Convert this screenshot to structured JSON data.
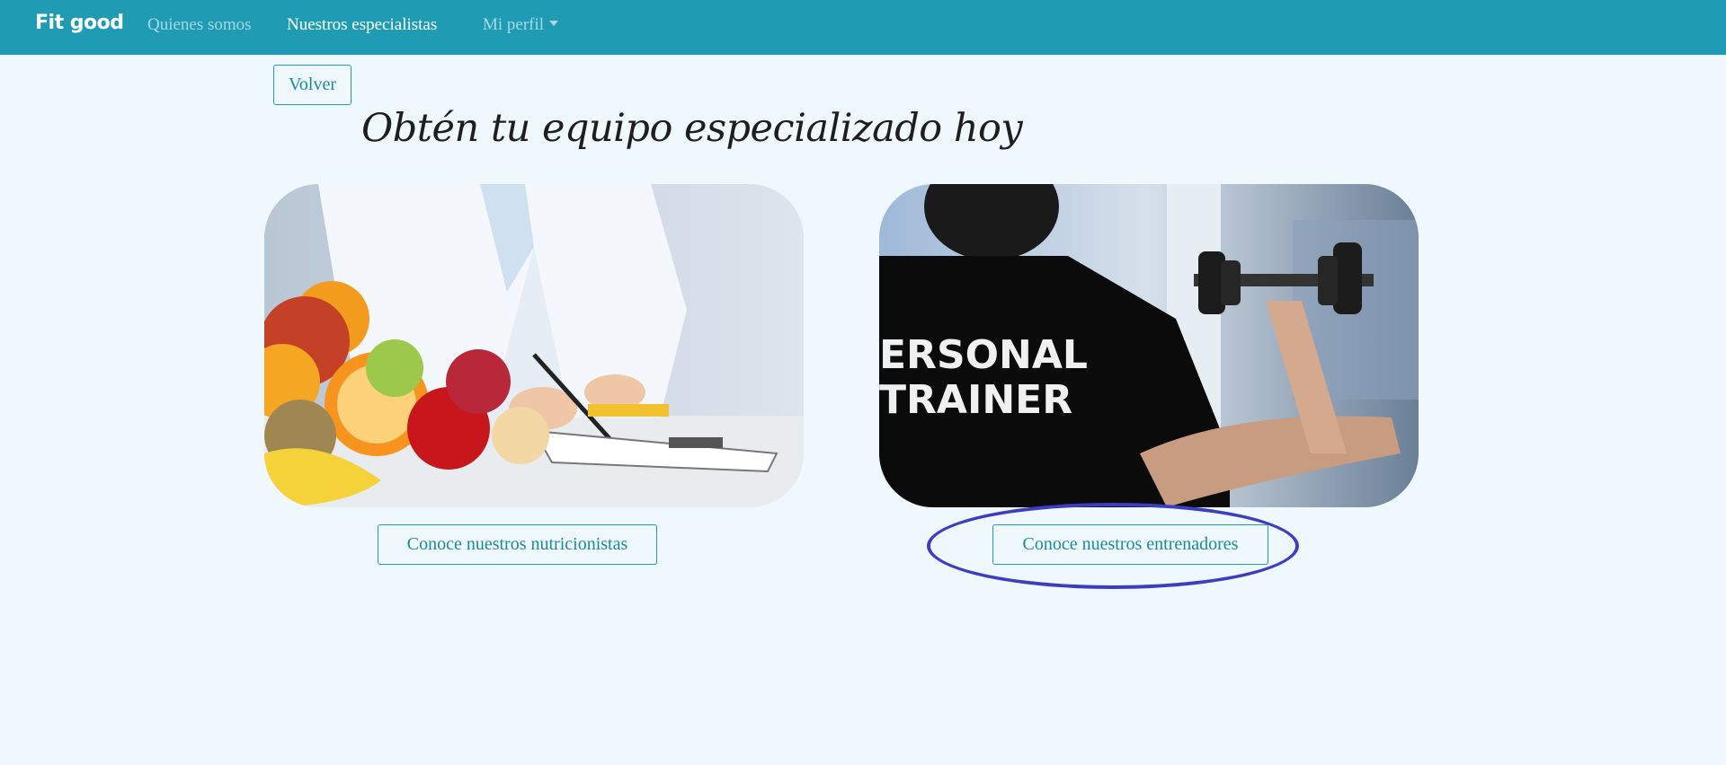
{
  "navbar": {
    "brand": "Fit good",
    "links": [
      {
        "label": "Quienes somos",
        "state": "inactive"
      },
      {
        "label": "Nuestros especialistas",
        "state": "active"
      },
      {
        "label": "Mi perfil",
        "state": "inactive",
        "dropdown": true
      }
    ],
    "color": "#1f9cb4"
  },
  "main": {
    "back_button": "Volver",
    "title": "Obtén tu equipo especializado hoy",
    "cards": [
      {
        "image": "nutritionist-photo",
        "button": "Conoce nuestros nutricionistas"
      },
      {
        "image": "personal-trainer-photo",
        "shirt_text_line1": "ERSONAL",
        "shirt_text_line2": "TRAINER",
        "button": "Conoce nuestros entrenadores"
      }
    ]
  },
  "colors": {
    "background": "#eff8fd",
    "accent": "#1f9cb4",
    "annotation": "#3d3dc2"
  }
}
